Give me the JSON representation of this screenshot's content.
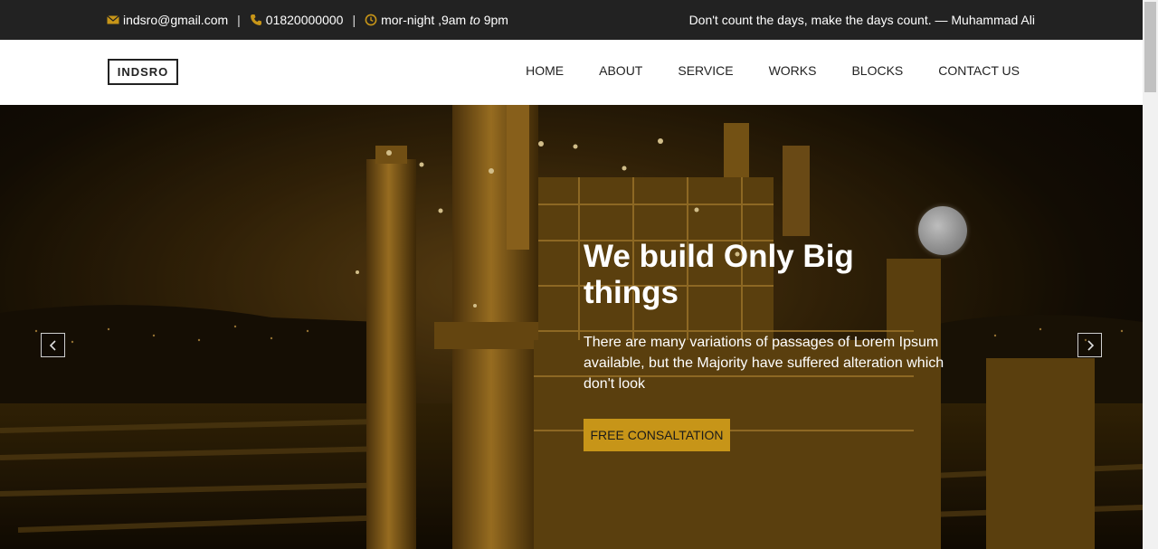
{
  "topbar": {
    "email": "indsro@gmail.com",
    "phone": "01820000000",
    "hours_prefix": "mor-night ,9am ",
    "hours_to": "to",
    "hours_suffix": " 9pm",
    "separator": "|",
    "quote": "Don't count the days, make the days count. — Muhammad Ali",
    "icon_color": "#c79518"
  },
  "header": {
    "logo": "INDSRO",
    "nav": [
      "HOME",
      "ABOUT",
      "SERVICE",
      "WORKS",
      "BLOCKS",
      "CONTACT US"
    ]
  },
  "hero": {
    "title": "We build Only Big things",
    "text": "There are many variations of passages of Lorem Ipsum available, but the Majority have suffered alteration which don't look",
    "cta": "FREE CONSALTATION",
    "accent": "#c79518",
    "prev_icon": "chevron-left-icon",
    "next_icon": "chevron-right-icon"
  }
}
